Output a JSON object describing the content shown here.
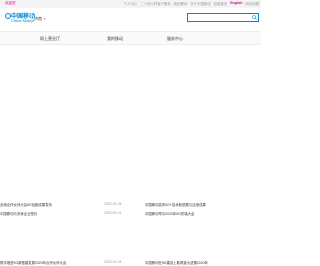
{
  "topbar": {
    "welcome": "欢迎您",
    "links": [
      "个人中心",
      "二十四小时客户服务",
      "我的移动",
      "关于中国移动",
      "旧版首页",
      "English",
      "网站地图"
    ],
    "highlight": "English"
  },
  "header": {
    "logo_cn": "中国移动",
    "logo_en": "China Mobile",
    "city": "济南",
    "search_placeholder": ""
  },
  "nav": {
    "items": [
      "网上营业厅",
      "我的移动",
      "服务中心"
    ]
  },
  "news": {
    "left": [
      {
        "title": "全球合作伙伴大会5G创新成果发布",
        "date": "2020-09-28"
      },
      {
        "title": "中国移动与多家企业签约",
        "date": "2020-09-21"
      },
      {
        "title": "携手推进5G新基建发展2020年合作伙伴大会",
        "date": "2020-09-18"
      }
    ],
    "right": [
      {
        "title": "中国移动发布5G+技术新进展与应用成果",
        "date": ""
      },
      {
        "title": "中国移动举办2020年5G终端大会",
        "date": ""
      },
      {
        "title": "中国移动在5G建设上取得重大进展2020年",
        "date": ""
      }
    ]
  }
}
